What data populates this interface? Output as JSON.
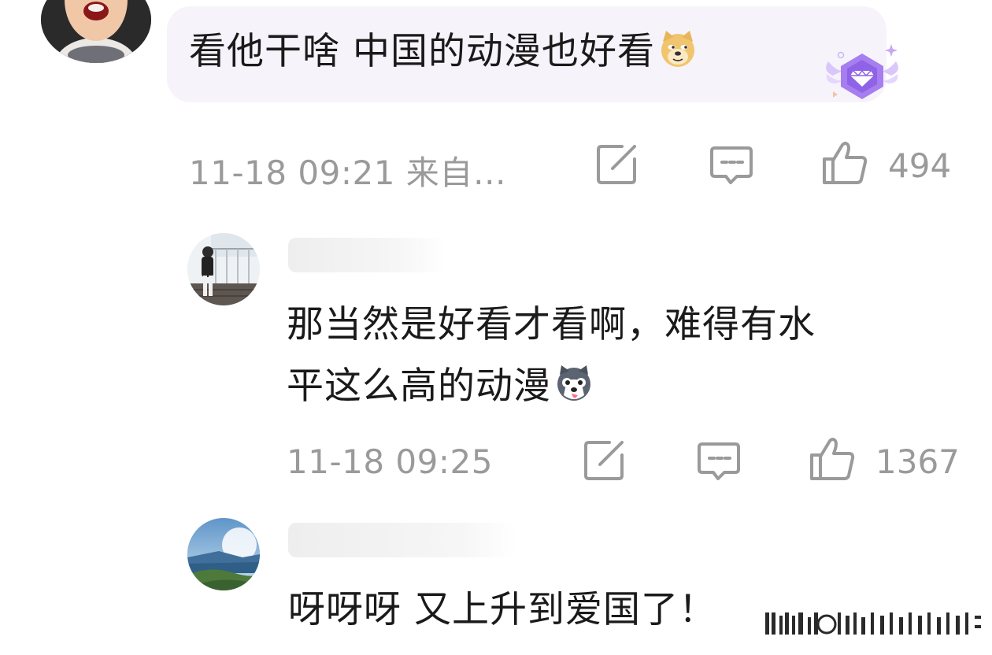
{
  "comments": [
    {
      "text": "看他干啥 中国的动漫也好看",
      "emoji_icon": "doge-emoji-icon",
      "time": "11-18 09:21 来自…",
      "likes": "494",
      "badge_icon": "purple-diamond-badge-icon"
    },
    {
      "text_line1": "那当然是好看才看啊，难得有水",
      "text_line2": "平这么高的动漫",
      "emoji_icon": "husky-emoji-icon",
      "time": "11-18 09:25",
      "likes": "1367"
    },
    {
      "text": "呀呀呀 又上升到爱国了！"
    }
  ],
  "actions": {
    "share_icon": "share-icon",
    "comment_icon": "comment-icon",
    "like_icon": "thumbs-up-icon"
  },
  "colors": {
    "meta_gray": "#9a9a9a",
    "highlight_bg": "#f6f3fb",
    "badge_purple": "#a77ef0"
  }
}
